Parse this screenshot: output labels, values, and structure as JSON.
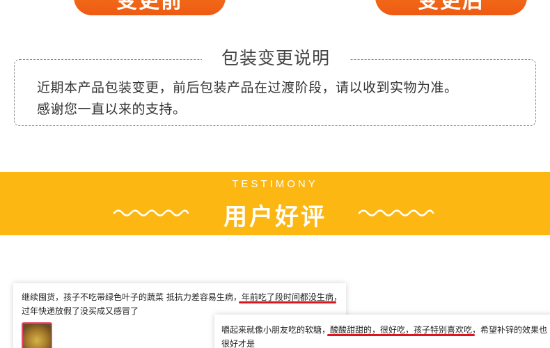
{
  "header": {
    "before_label": "变更前",
    "after_label": "变更后"
  },
  "notice": {
    "title": "包装变更说明",
    "line1": "近期本产品包装变更，前后包装产品在过渡阶段，请以收到实物为准。",
    "line2": "感谢您一直以来的支持。"
  },
  "testimony": {
    "en_title": "TESTIMONY",
    "cn_title": "用户好评"
  },
  "reviews": [
    {
      "part1": "继续囤货，孩子不吃带绿色叶子的蔬菜 抵抗力差容易生病，",
      "highlight1": "年前吃了段时间都没生病",
      "part2": "，过年快递放假了没买成又感冒了"
    },
    {
      "part1": "嚼起来就像小朋友吃的软糖，",
      "highlight1": "酸酸甜甜的，很好吃，孩子特别喜欢吃",
      "part2": "，希望补锌的效果也很好才是"
    }
  ],
  "colors": {
    "pill_orange": "#ee5a12",
    "band_yellow": "#fcb712",
    "highlight_red": "#e0141e"
  }
}
